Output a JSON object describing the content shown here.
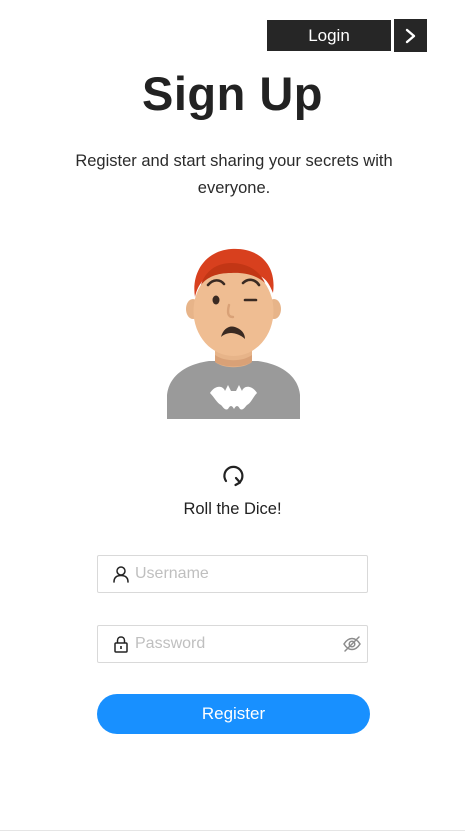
{
  "header": {
    "login_label": "Login"
  },
  "main": {
    "title": "Sign Up",
    "subtitle": "Register and start sharing your secrets with everyone.",
    "roll_label": "Roll the Dice!"
  },
  "form": {
    "username_placeholder": "Username",
    "password_placeholder": "Password",
    "register_label": "Register"
  },
  "icons": {
    "login_arrow": "chevron-right-icon",
    "dice": "refresh-icon",
    "username": "user-icon",
    "password": "lock-icon",
    "visibility": "eye-invisible-icon"
  },
  "colors": {
    "primary": "#1890ff",
    "dark_button": "#262626",
    "border": "#d9d9d9",
    "placeholder": "#bfbfbf"
  }
}
